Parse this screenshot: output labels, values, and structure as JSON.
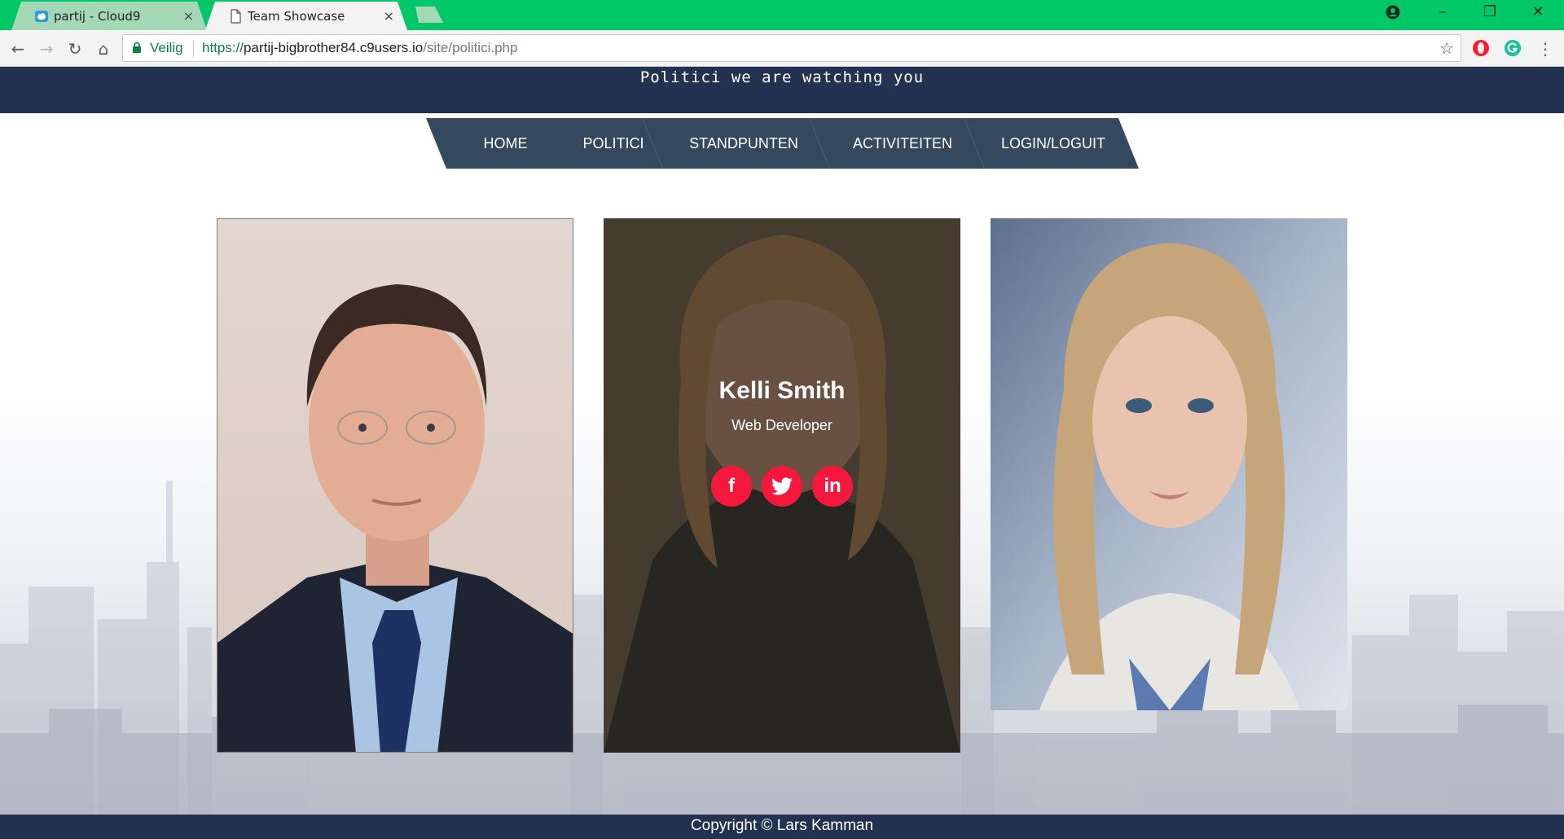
{
  "browser": {
    "tabs": [
      {
        "title": "partij - Cloud9",
        "icon": "cloud9-icon",
        "active": false
      },
      {
        "title": "Team Showcase",
        "icon": "page-icon",
        "active": true
      }
    ],
    "close_glyph": "×",
    "toolbar": {
      "back_glyph": "←",
      "forward_glyph": "→",
      "reload_glyph": "↻",
      "home_glyph": "⌂",
      "security_label": "Veilig",
      "url_scheme": "https://",
      "url_host": "partij-bigbrother84.c9users.io",
      "url_path": "/site/politici.php",
      "star_glyph": "☆",
      "menu_glyph": "⋮"
    },
    "window_controls": {
      "minimize": "–",
      "restore": "❐",
      "close": "✕"
    },
    "accent_color": "#00c767"
  },
  "site": {
    "title": "Politici we are watching you",
    "header_color": "#233250",
    "menu": {
      "items": [
        "HOME",
        "POLITICI",
        "STANDPUNTEN",
        "ACTIVITEITEN",
        "LOGIN/LOGUIT"
      ],
      "color": "#34495e"
    },
    "cards": [
      {
        "photo": "man-in-suit-portrait"
      },
      {
        "photo": "woman-smiling-portrait",
        "name": "Kelli Smith",
        "role": "Web Developer",
        "socials": [
          {
            "icon": "facebook-icon",
            "glyph": "f"
          },
          {
            "icon": "twitter-icon",
            "glyph": "🐦"
          },
          {
            "icon": "linkedin-icon",
            "glyph": "in"
          }
        ],
        "social_color": "#f5173c"
      },
      {
        "photo": "woman-blonde-portrait"
      }
    ],
    "footer": {
      "text": "Copyright © Lars Kamman"
    }
  }
}
